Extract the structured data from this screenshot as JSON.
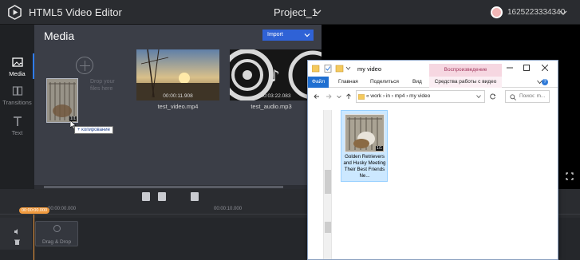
{
  "app": {
    "title": "HTML5 Video Editor",
    "project": "Project_1",
    "user_id": "1625223334340"
  },
  "nav": [
    {
      "label": "Media",
      "icon": "image-icon",
      "active": true
    },
    {
      "label": "Transitions",
      "icon": "transitions-icon",
      "active": false
    },
    {
      "label": "Text",
      "icon": "text-icon",
      "active": false
    }
  ],
  "media": {
    "title": "Media",
    "import_label": "Import",
    "drop_hint": "Drop your\nfiles here",
    "items": [
      {
        "name": "test_video.mp4",
        "duration": "00:00:11.908",
        "kind": "video"
      },
      {
        "name": "test_audio.mp3",
        "duration": "00:03:22.083",
        "kind": "audio"
      }
    ],
    "drag": {
      "badge": "1/1",
      "tooltip": "+ копирование"
    }
  },
  "timeline": {
    "playhead_time": "00:00:00.000",
    "ruler_times": [
      "00:00:00.000",
      "00:00:10.000"
    ],
    "drop_label": "Drag & Drop"
  },
  "explorer": {
    "window_title": "my video",
    "context_group": "Воспроизведение",
    "ribbon_tabs": [
      "Файл",
      "Главная",
      "Поделиться",
      "Вид",
      "Средства работы с видео"
    ],
    "address_path": "« work › in › mp4 › my video",
    "search_placeholder": "Поиск: m...",
    "file": {
      "name": "Golden Retrievers and Husky Meeting Their Best Friends Ne...",
      "badge": "1/1"
    }
  },
  "colors": {
    "accent_blue": "#2f62d6",
    "playhead_orange": "#f09a3e",
    "explorer_file_tab": "#1f6fd1",
    "explorer_context": "#f6d7e1"
  }
}
